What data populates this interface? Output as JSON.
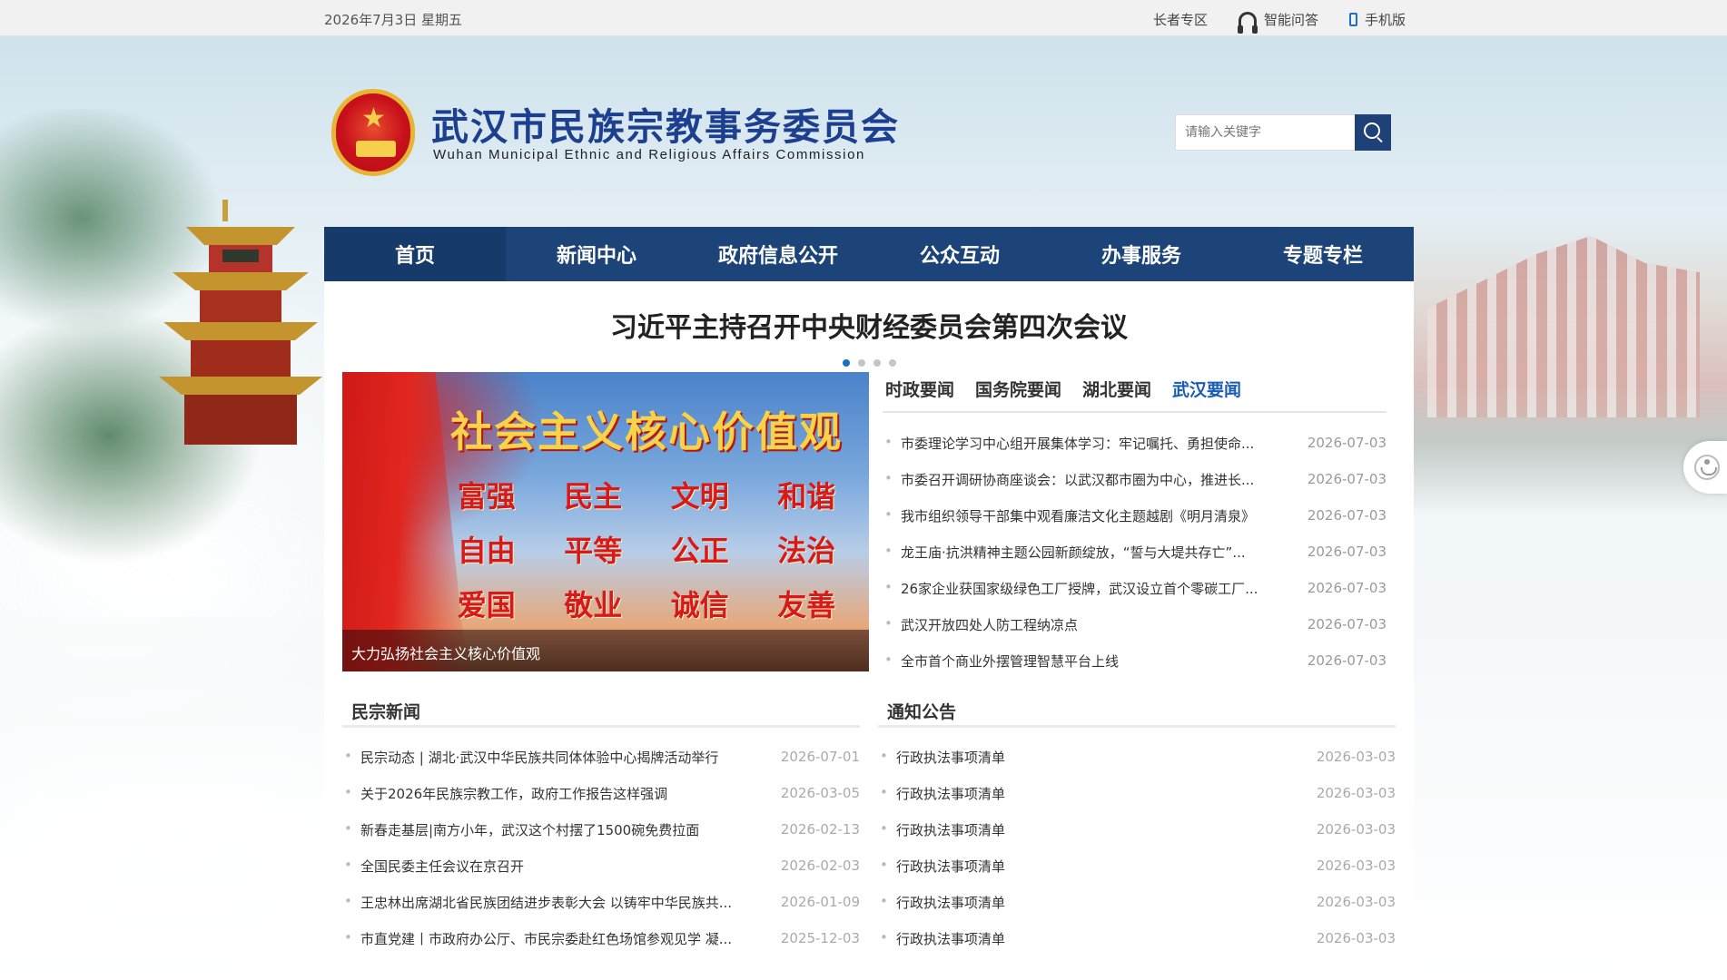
{
  "topbar": {
    "date": "2026年7月3日 星期五",
    "elder_zone": "长者专区",
    "smart_qa": "智能问答",
    "mobile": "手机版"
  },
  "header": {
    "title": "武汉市民族宗教事务委员会",
    "subtitle": "Wuhan Municipal Ethnic and Religious Affairs Commission"
  },
  "search": {
    "placeholder": "请输入关键字"
  },
  "nav": {
    "items": [
      {
        "label": "首页"
      },
      {
        "label": "新闻中心"
      },
      {
        "label": "政府信息公开"
      },
      {
        "label": "公众互动"
      },
      {
        "label": "办事服务"
      },
      {
        "label": "专题专栏"
      }
    ],
    "active_index": 0
  },
  "headline": "习近平主持召开中央财经委员会第四次会议",
  "carousel": {
    "dot_count": 4,
    "active_dot": 0
  },
  "banner": {
    "title": "社会主义核心价值观",
    "values": [
      "富强",
      "民主",
      "文明",
      "和谐",
      "自由",
      "平等",
      "公正",
      "法治",
      "爱国",
      "敬业",
      "诚信",
      "友善"
    ],
    "caption": "大力弘扬社会主义核心价值观"
  },
  "news_tabs": {
    "items": [
      {
        "label": "时政要闻"
      },
      {
        "label": "国务院要闻"
      },
      {
        "label": "湖北要闻"
      },
      {
        "label": "武汉要闻"
      }
    ],
    "active_index": 3
  },
  "news_list": [
    {
      "title": "市委理论学习中心组开展集体学习：牢记嘱托、勇担使命...",
      "date": "2026-07-03"
    },
    {
      "title": "市委召开调研协商座谈会：以武汉都市圈为中心，推进长...",
      "date": "2026-07-03"
    },
    {
      "title": "我市组织领导干部集中观看廉洁文化主题越剧《明月清泉》",
      "date": "2026-07-03"
    },
    {
      "title": "龙王庙·抗洪精神主题公园新颜绽放，“誓与大堤共存亡”...",
      "date": "2026-07-03"
    },
    {
      "title": "26家企业获国家级绿色工厂授牌，武汉设立首个零碳工厂...",
      "date": "2026-07-03"
    },
    {
      "title": "武汉开放四处人防工程纳凉点",
      "date": "2026-07-03"
    },
    {
      "title": "全市首个商业外摆管理智慧平台上线",
      "date": "2026-07-03"
    }
  ],
  "ethnic_news": {
    "heading": "民宗新闻",
    "items": [
      {
        "title": "民宗动态 | 湖北·武汉中华民族共同体体验中心揭牌活动举行",
        "date": "2026-07-01"
      },
      {
        "title": "关于2026年民族宗教工作，政府工作报告这样强调",
        "date": "2026-03-05"
      },
      {
        "title": "新春走基层|南方小年，武汉这个村摆了1500碗免费拉面",
        "date": "2026-02-13"
      },
      {
        "title": "全国民委主任会议在京召开",
        "date": "2026-02-03"
      },
      {
        "title": "王忠林出席湖北省民族团结进步表彰大会 以铸牢中华民族共...",
        "date": "2026-01-09"
      },
      {
        "title": "市直党建丨市政府办公厅、市民宗委赴红色场馆参观见学 凝...",
        "date": "2025-12-03"
      }
    ]
  },
  "notices": {
    "heading": "通知公告",
    "items": [
      {
        "title": "行政执法事项清单",
        "date": "2026-03-03"
      },
      {
        "title": "行政执法事项清单",
        "date": "2026-03-03"
      },
      {
        "title": "行政执法事项清单",
        "date": "2026-03-03"
      },
      {
        "title": "行政执法事项清单",
        "date": "2026-03-03"
      },
      {
        "title": "行政执法事项清单",
        "date": "2026-03-03"
      },
      {
        "title": "行政执法事项清单",
        "date": "2026-03-03"
      }
    ]
  },
  "colors": {
    "nav_bg": "#1d4478",
    "nav_active": "#163a6a",
    "title_blue": "#1c3f8f",
    "active_tab": "#1a5bb3",
    "search_btn": "#1e4278"
  }
}
